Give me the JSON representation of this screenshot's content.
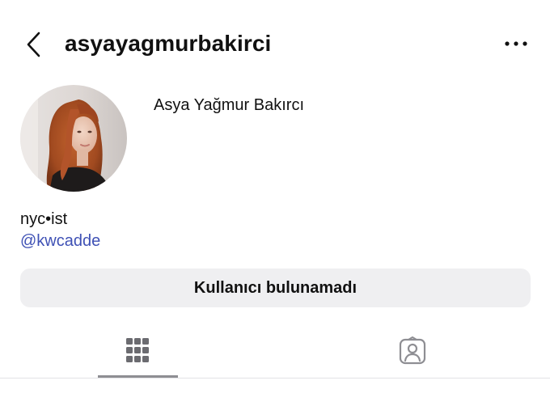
{
  "header": {
    "username": "asyayagmurbakirci",
    "back_icon": "chevron-left-icon",
    "more_icon": "ellipsis-icon"
  },
  "profile": {
    "full_name": "Asya Yağmur Bakırcı",
    "bio": "nyc•ist",
    "bio_link": "@kwcadde",
    "link_color": "#3f51b5"
  },
  "status_button": {
    "label": "Kullanıcı bulunamadı"
  },
  "tabs": [
    {
      "name": "posts-grid",
      "icon": "grid-icon",
      "active": true
    },
    {
      "name": "tagged",
      "icon": "tagged-person-icon",
      "active": false
    }
  ]
}
